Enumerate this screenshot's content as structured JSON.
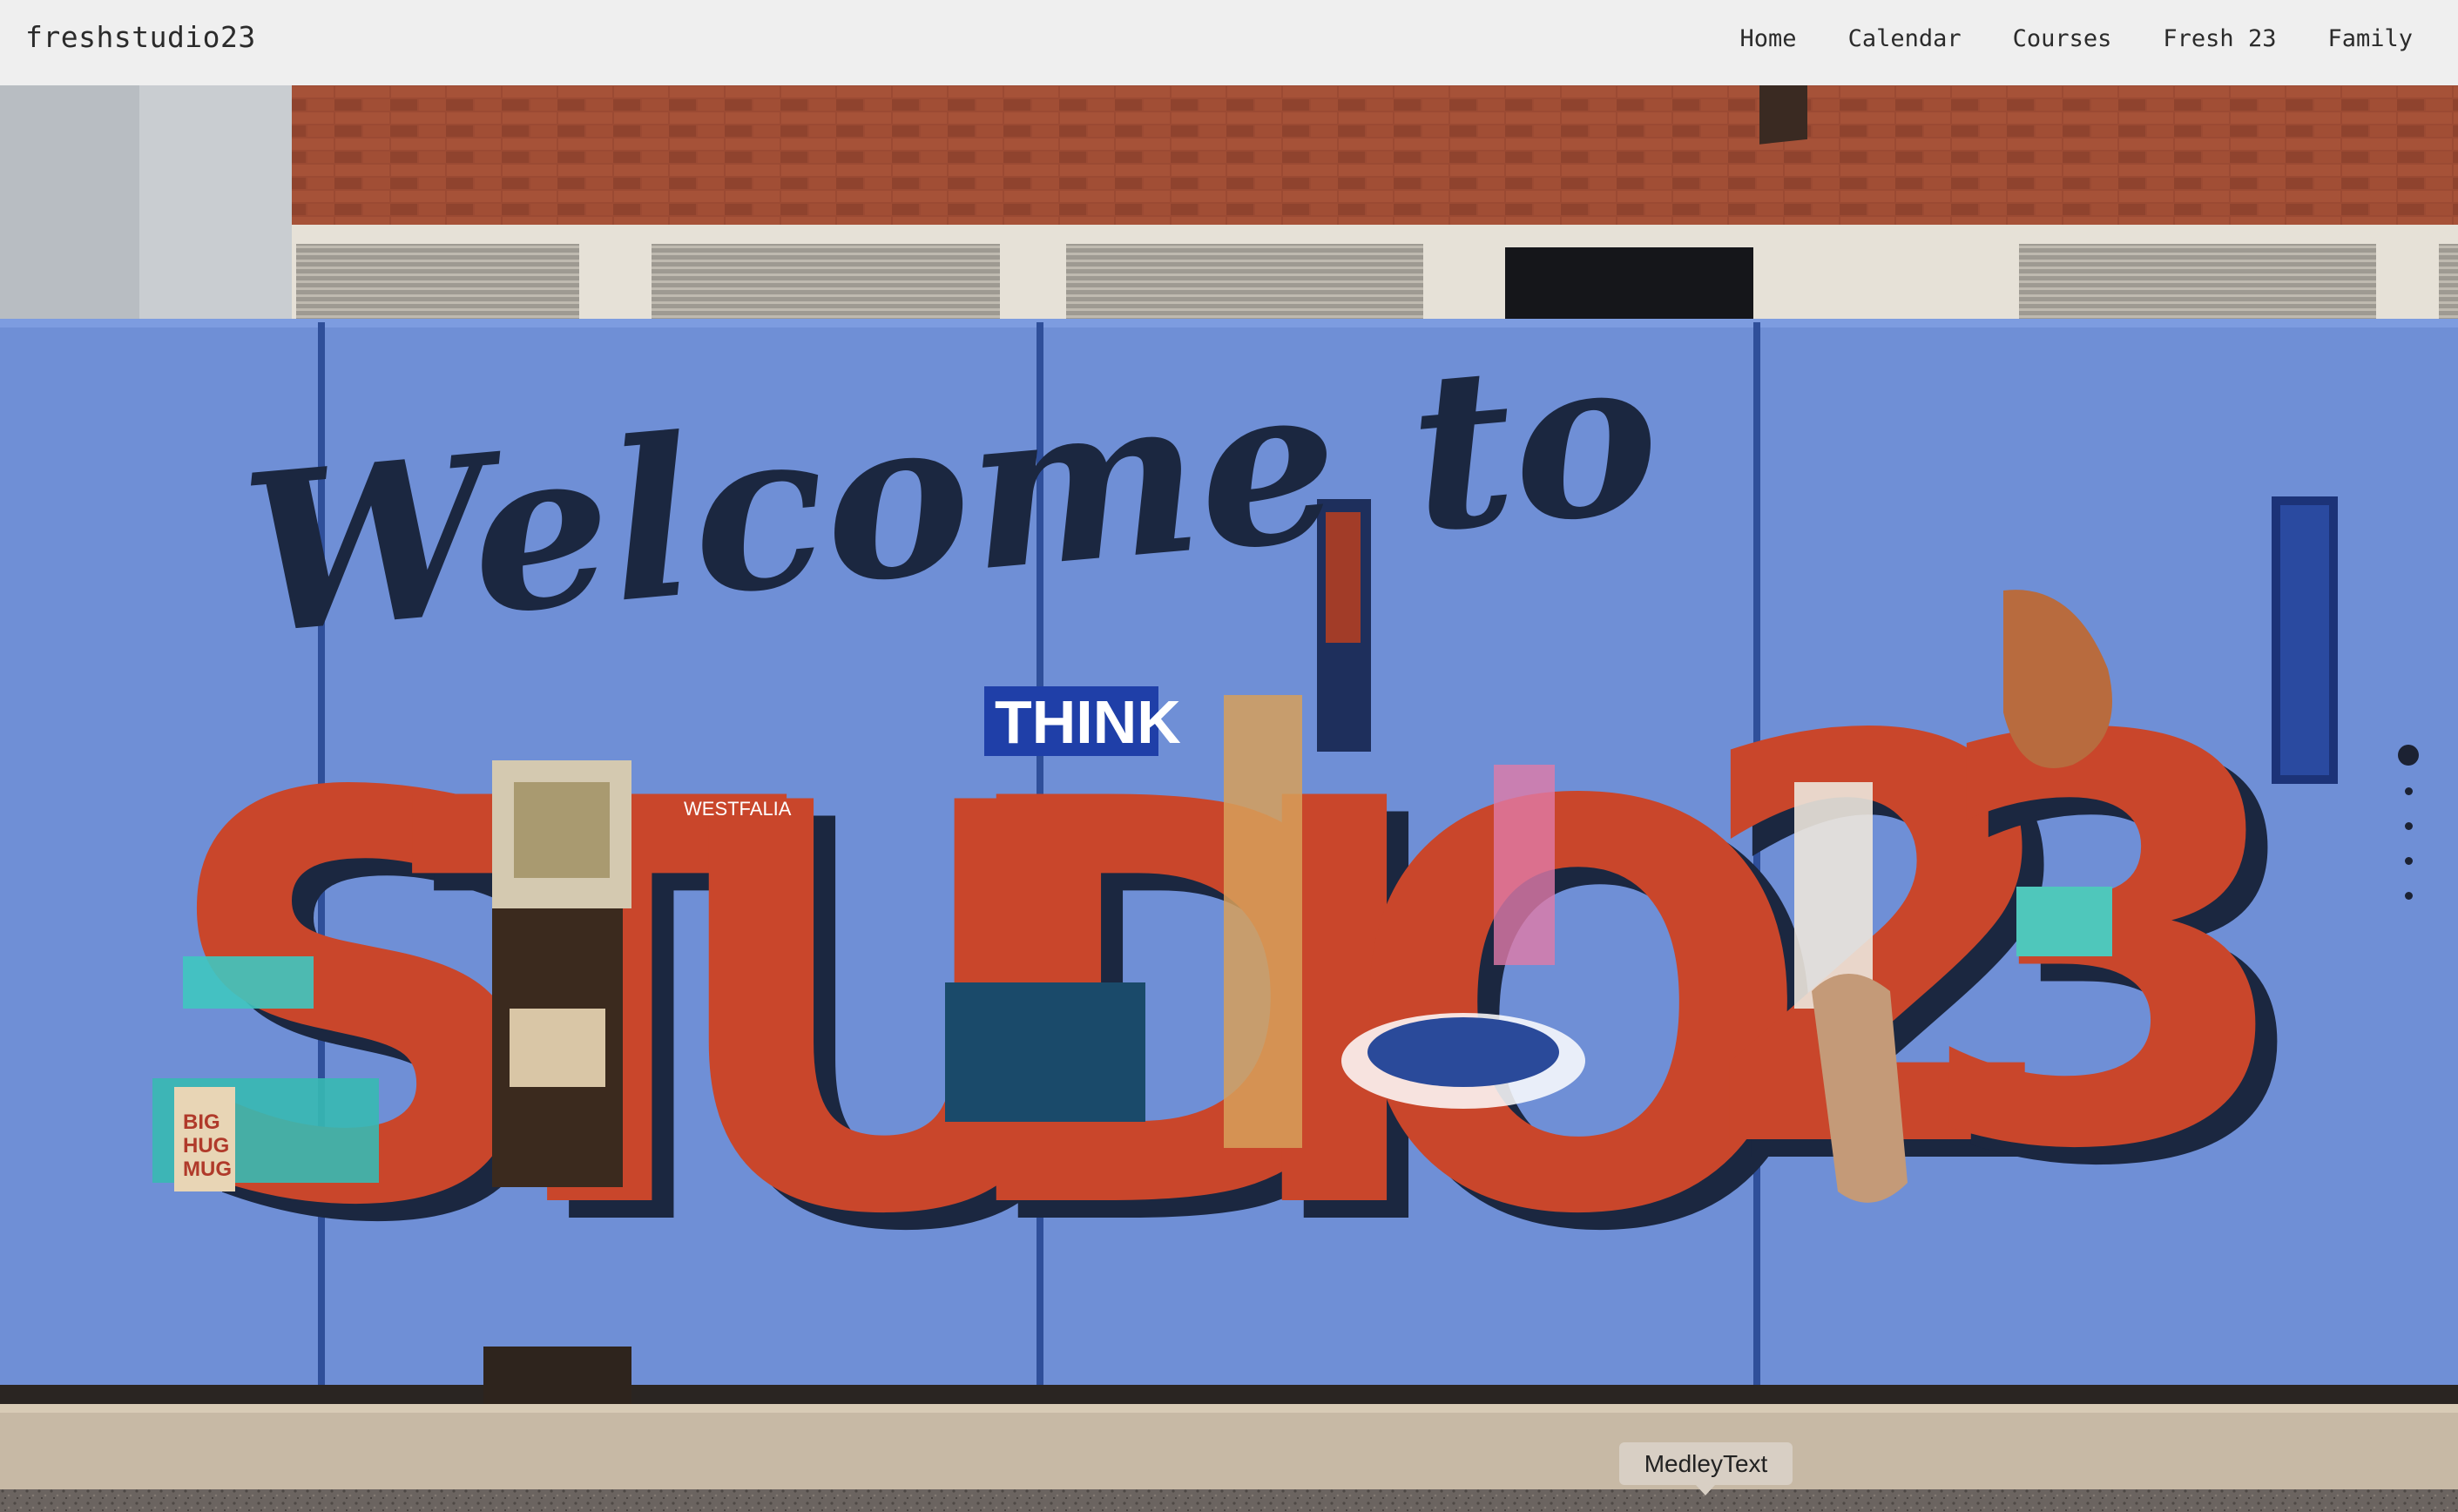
{
  "site": {
    "logo": "freshstudio23"
  },
  "nav": {
    "items": [
      {
        "label": "Home"
      },
      {
        "label": "Calendar"
      },
      {
        "label": "Courses"
      },
      {
        "label": "Fresh 23"
      },
      {
        "label": "Family"
      }
    ]
  },
  "hero": {
    "mural": {
      "script_text": "Welcome to",
      "letters": [
        "S",
        "T",
        "U",
        "D",
        "I",
        "O",
        "2",
        "3"
      ],
      "think_sign": "THINK",
      "westfalia_label": "WESTFALIA",
      "mug_text": [
        "BIG",
        "HUG",
        "MUG"
      ],
      "pennants": [
        "2",
        "3"
      ]
    },
    "slides": {
      "count": 5,
      "active_index": 0
    },
    "caption": "MedleyText"
  },
  "colors": {
    "header_bg": "#efefef",
    "wall_blue": "#6f8fd6",
    "brick": "#9a4a33",
    "letter_red": "#c9462b",
    "letter_navy": "#1c2a44",
    "caption_bg": "#d8cfc4"
  }
}
